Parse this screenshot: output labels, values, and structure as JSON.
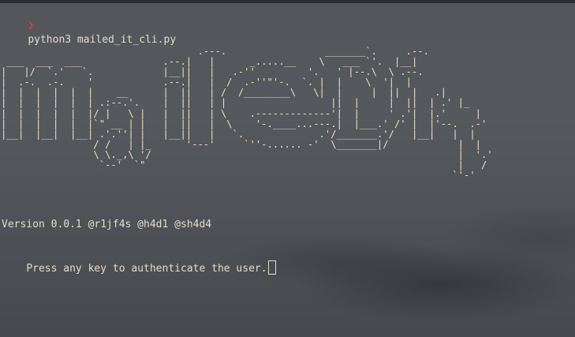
{
  "terminal": {
    "prompt_symbol": "❯",
    "command": "python3 mailed_it_cli.py",
    "banner_lines": [
      "                                  .---.                 _______`.     .--.",
      " ___  ___  ___              .--.|   |      _.....__    \\   ___ `'.  |__|",
      "|   |/  `.'   `.            |__||   |   .-''         '.   ' |--.\\  \\ .--.",
      "|  .-.  .-.    '            .--.|   |  /  .-''\"'-.  `. |  |    \\  '|  |",
      "|  |  |  |  |  |    __      |  ||   | /  /________\\   \\|  |     |  ||  |   .|",
      "|  |  |  |  |  | .:--.'.    |  ||   | |                  ||  |     |  ||  | .' |_",
      "|  |  |  |  |  |/ |   \\ |   |  ||   | \\    .-------------'|  |     ' .'|  |.'     |",
      "|  |  |  |  |  |`\" __ | |   |  ||   |  \\    '-.____...---.|  |___.' /' |  |'--.  .-'",
      "|__|  |__|  |__| .'.''| |   |__||   |   `.             .'/_______.'/   |__|   |  |",
      "                / /   | |_      '---'     `''-...... -'  \\_______|/            |  |",
      "                \\ \\._,\\ '/                                                     |  '.'",
      "                 `--'  `\"                                                      |   /",
      "                                                                              `'-'"
    ],
    "version_line": "Version 0.0.1 @r1jf4s @h4d1 @sh4d4",
    "press_line": "Press any key to authenticate the user."
  }
}
